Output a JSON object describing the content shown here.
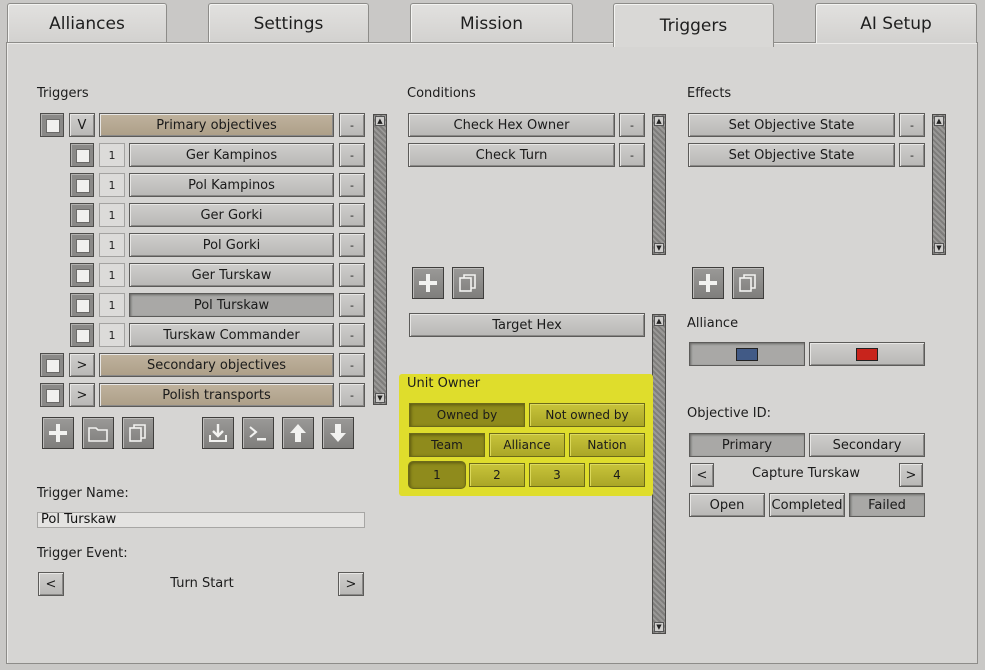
{
  "tabs": [
    "Alliances",
    "Settings",
    "Mission",
    "Triggers",
    "AI Setup"
  ],
  "triggers": {
    "heading": "Triggers",
    "groups": [
      {
        "toggle": "V",
        "label": "Primary objectives",
        "remove": "-"
      },
      {
        "toggle": ">",
        "label": "Secondary objectives",
        "remove": "-"
      },
      {
        "toggle": ">",
        "label": "Polish transports",
        "remove": "-"
      }
    ],
    "items": [
      {
        "num": "1",
        "label": "Ger Kampinos",
        "remove": "-"
      },
      {
        "num": "1",
        "label": "Pol Kampinos",
        "remove": "-"
      },
      {
        "num": "1",
        "label": "Ger Gorki",
        "remove": "-"
      },
      {
        "num": "1",
        "label": "Pol Gorki",
        "remove": "-"
      },
      {
        "num": "1",
        "label": "Ger Turskaw",
        "remove": "-"
      },
      {
        "num": "1",
        "label": "Pol Turskaw",
        "remove": "-"
      },
      {
        "num": "1",
        "label": "Turskaw Commander",
        "remove": "-"
      }
    ],
    "name_label": "Trigger Name:",
    "name_value": "Pol Turskaw",
    "event_label": "Trigger Event:",
    "event_prev": "<",
    "event_value": "Turn Start",
    "event_next": ">"
  },
  "conditions": {
    "heading": "Conditions",
    "items": [
      {
        "label": "Check Hex Owner",
        "remove": "-"
      },
      {
        "label": "Check Turn",
        "remove": "-"
      }
    ],
    "target_hex": "Target Hex",
    "unit_owner_label": "Unit Owner",
    "owned_by": "Owned by",
    "not_owned_by": "Not owned by",
    "team": "Team",
    "alliance": "Alliance",
    "nation": "Nation",
    "numbers": [
      "1",
      "2",
      "3",
      "4"
    ]
  },
  "effects": {
    "heading": "Effects",
    "items": [
      {
        "label": "Set Objective State",
        "remove": "-"
      },
      {
        "label": "Set Objective State",
        "remove": "-"
      }
    ],
    "alliance_label": "Alliance",
    "alliance_colors": [
      "#415a86",
      "#c8241c"
    ],
    "objective_id_label": "Objective ID:",
    "primary": "Primary",
    "secondary": "Secondary",
    "obj_prev": "<",
    "objective_name": "Capture Turskaw",
    "obj_next": ">",
    "open": "Open",
    "completed": "Completed",
    "failed": "Failed"
  },
  "icons": {
    "add": "plus-icon",
    "folder": "folder-icon",
    "copy": "copy-icon",
    "import": "import-icon",
    "console": "console-icon",
    "up": "arrow-up-icon",
    "down": "arrow-down-icon"
  }
}
